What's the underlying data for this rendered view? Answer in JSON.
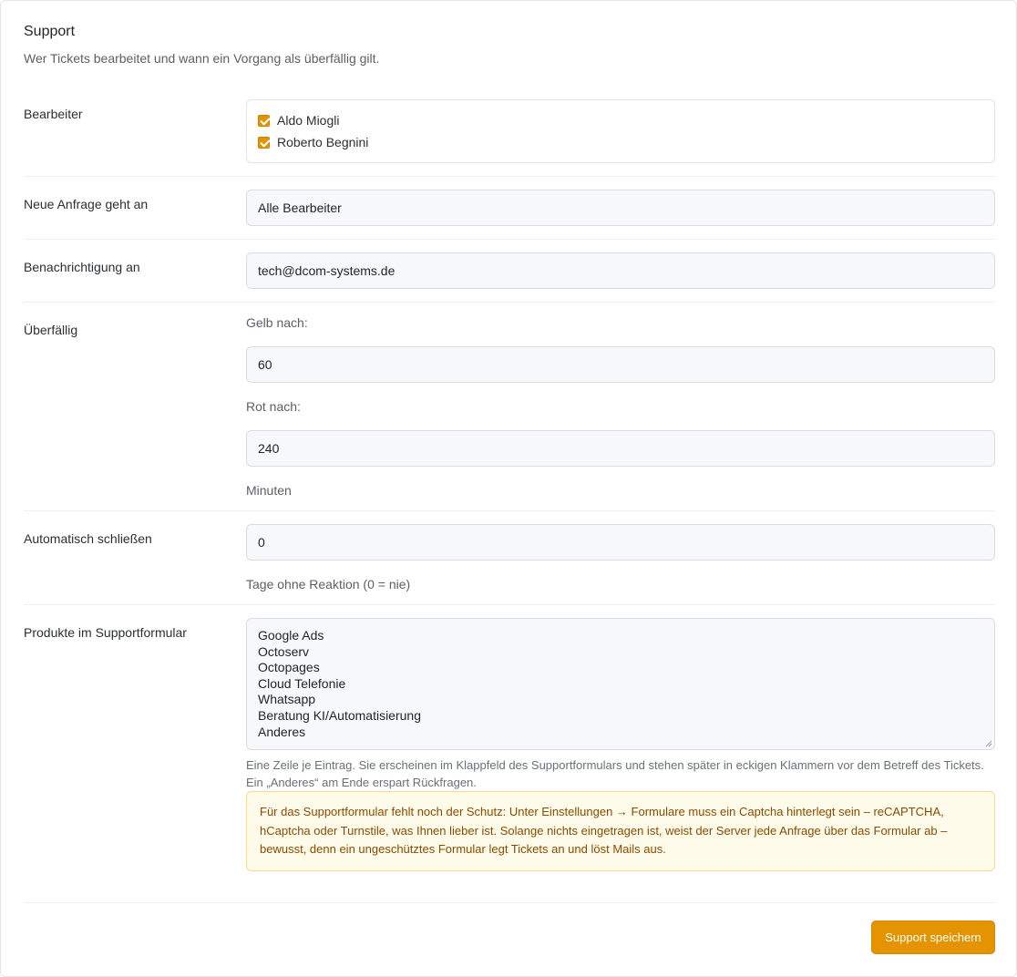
{
  "section": {
    "title": "Support",
    "subtitle": "Wer Tickets bearbeitet und wann ein Vorgang als überfällig gilt."
  },
  "bearbeiter": {
    "label": "Bearbeiter",
    "options": [
      {
        "name": "Aldo Miogli",
        "checked": true
      },
      {
        "name": "Roberto Begnini",
        "checked": true
      }
    ]
  },
  "neue_anfrage": {
    "label": "Neue Anfrage geht an",
    "value": "Alle Bearbeiter"
  },
  "benachrichtigung": {
    "label": "Benachrichtigung an",
    "value": "tech@dcom-systems.de"
  },
  "ueberfaellig": {
    "label": "Überfällig",
    "gelb_label": "Gelb nach:",
    "gelb_value": "60",
    "rot_label": "Rot nach:",
    "rot_value": "240",
    "unit": "Minuten"
  },
  "auto_close": {
    "label": "Automatisch schließen",
    "value": "0",
    "hint": "Tage ohne Reaktion (0 = nie)"
  },
  "produkte": {
    "label": "Produkte im Supportformular",
    "lines": [
      "Google Ads",
      "Octoserv",
      "Octopages",
      "Cloud Telefonie",
      "Whatsapp",
      "Beratung KI/Automatisierung",
      "Anderes"
    ],
    "help_line1": "Eine Zeile je Eintrag. Sie erscheinen im Klappfeld des Supportformulars und stehen später in eckigen Klammern vor dem Betreff des Tickets.",
    "help_line2": "Ein „Anderes“ am Ende erspart Rückfragen.",
    "warning_line1": "Für das Supportformular fehlt noch der Schutz: Unter Einstellungen → Formulare muss ein Captcha hinterlegt sein – reCAPTCHA,",
    "warning_line2": "hCaptcha oder Turnstile, was Ihnen lieber ist. Solange nichts eingetragen ist, weist der Server jede Anfrage über das Formular ab –",
    "warning_line3": "bewusst, denn ein ungeschütztes Formular legt Tickets an und löst Mails aus."
  },
  "actions": {
    "save_label": "Support speichern"
  },
  "colors": {
    "accent": "#e39400",
    "warning_bg": "#fffbea",
    "warning_text": "#8a4b00"
  }
}
